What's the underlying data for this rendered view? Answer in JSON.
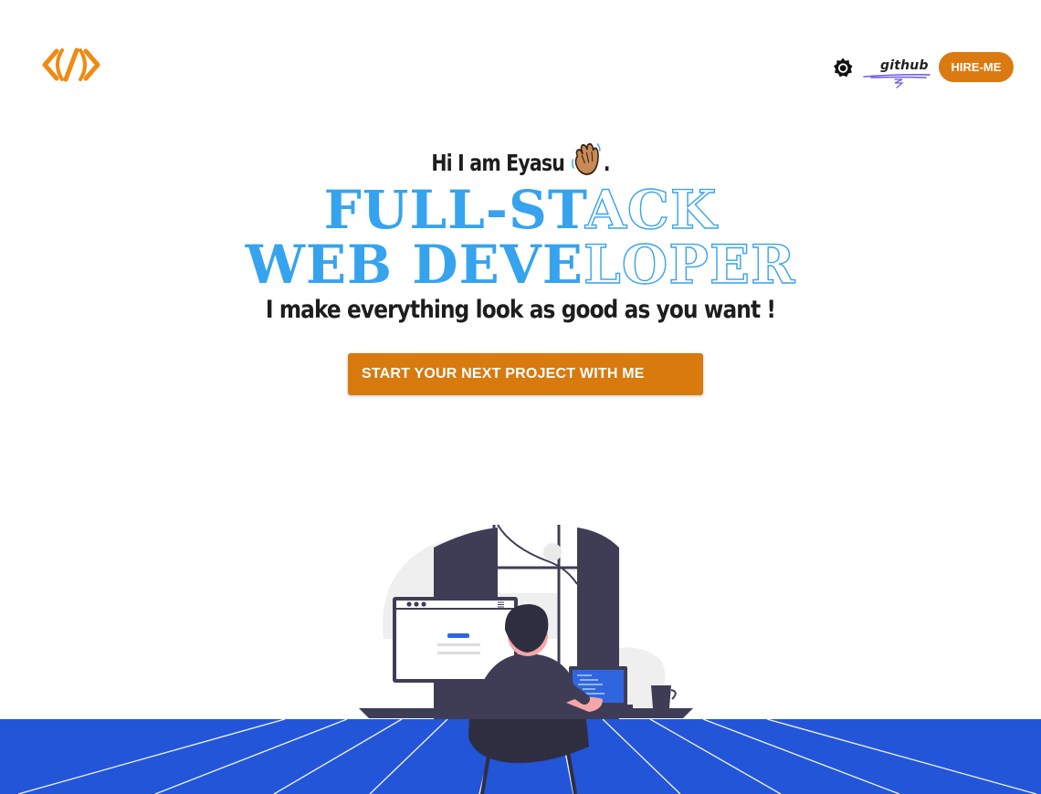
{
  "nav": {
    "logo_icon": "code-brackets-icon",
    "theme_icon": "brightness-icon",
    "github_label": "github",
    "hire_label": "HIRE-ME"
  },
  "hero": {
    "greeting": "Hi I am Eyasu",
    "greeting_suffix": ".",
    "wave_icon": "waving-hand-icon",
    "line1_filled": "FULL-ST",
    "line1_outline": "ACK",
    "line2_filled": "WEB DEVE",
    "line2_outline": "LOPER",
    "tagline": "I make everything look as good as you want !",
    "cta_label": "START YOUR NEXT PROJECT WITH ME"
  },
  "colors": {
    "accent": "#db7a10",
    "headline_blue": "#36a3ee",
    "floor_blue": "#2255d8",
    "text": "#1d1d1d"
  }
}
